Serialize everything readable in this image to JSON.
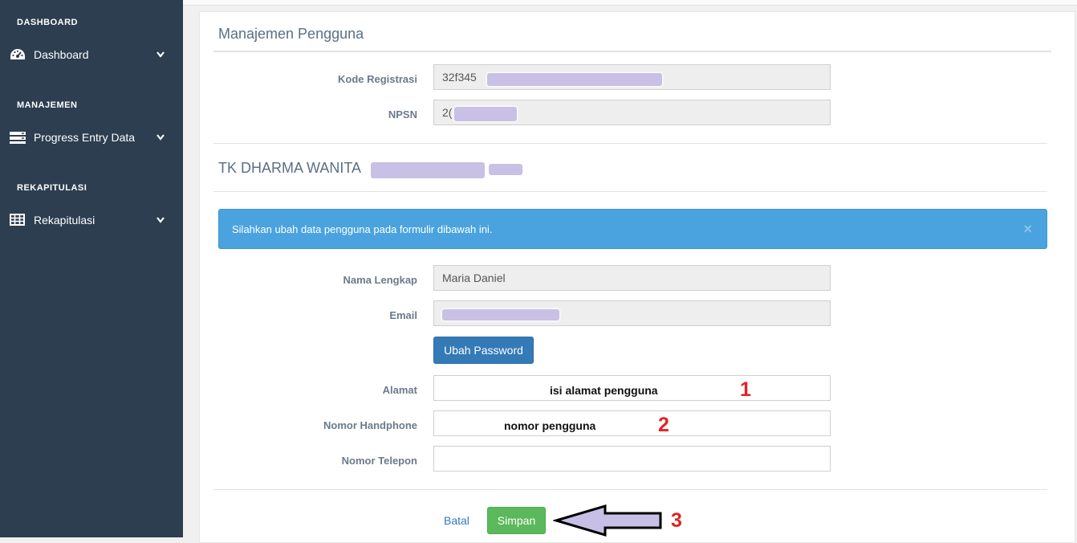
{
  "sidebar": {
    "sections": [
      {
        "header": "DASHBOARD",
        "item": "Dashboard",
        "icon": "dashboard-icon"
      },
      {
        "header": "MANAJEMEN",
        "item": "Progress Entry Data",
        "icon": "server-icon"
      },
      {
        "header": "REKAPITULASI",
        "item": "Rekapitulasi",
        "icon": "table-icon"
      }
    ]
  },
  "panel": {
    "title": "Manajemen Pengguna",
    "kode_registrasi": {
      "label": "Kode Registrasi",
      "value": "32f345"
    },
    "npsn": {
      "label": "NPSN",
      "value": "2("
    },
    "school_name": "TK DHARMA WANITA",
    "alert": {
      "text": "Silahkan ubah data pengguna pada formulir dibawah ini.",
      "close": "×"
    },
    "nama_lengkap": {
      "label": "Nama Lengkap",
      "value": "Maria Daniel"
    },
    "email": {
      "label": "Email",
      "value": ""
    },
    "ubah_password": "Ubah Password",
    "alamat": {
      "label": "Alamat",
      "value": ""
    },
    "nomor_handphone": {
      "label": "Nomor Handphone",
      "value": ""
    },
    "nomor_telepon": {
      "label": "Nomor Telepon",
      "value": ""
    },
    "batal": "Batal",
    "simpan": "Simpan"
  },
  "annotations": {
    "alamat_hint": "isi alamat pengguna",
    "hp_hint": "nomor pengguna",
    "step1": "1",
    "step2": "2",
    "step3": "3"
  },
  "colors": {
    "sidebar": "#2c3e50",
    "alert": "#4aa3df",
    "primary": "#337ab7",
    "success": "#5cb85c",
    "annotation_red": "#e02424",
    "arrow_fill": "#c8bfe7"
  }
}
